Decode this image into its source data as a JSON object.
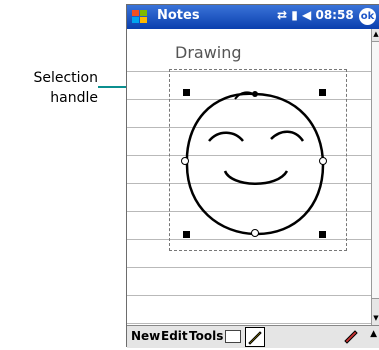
{
  "callout": {
    "line1": "Selection",
    "line2": "handle"
  },
  "titlebar": {
    "app": "Notes",
    "time": "08:58",
    "ok": "ok"
  },
  "document": {
    "title": "Drawing"
  },
  "menubar": {
    "new": "New",
    "edit": "Edit",
    "tools": "Tools"
  },
  "colors": {
    "titlebar": "#1f56c8",
    "leader": "#0b8f8f"
  },
  "icons": [
    "windows-flag-icon",
    "connectivity-icon",
    "signal-icon",
    "speaker-icon",
    "keyboard-icon",
    "pen-icon",
    "up-arrow-icon"
  ]
}
